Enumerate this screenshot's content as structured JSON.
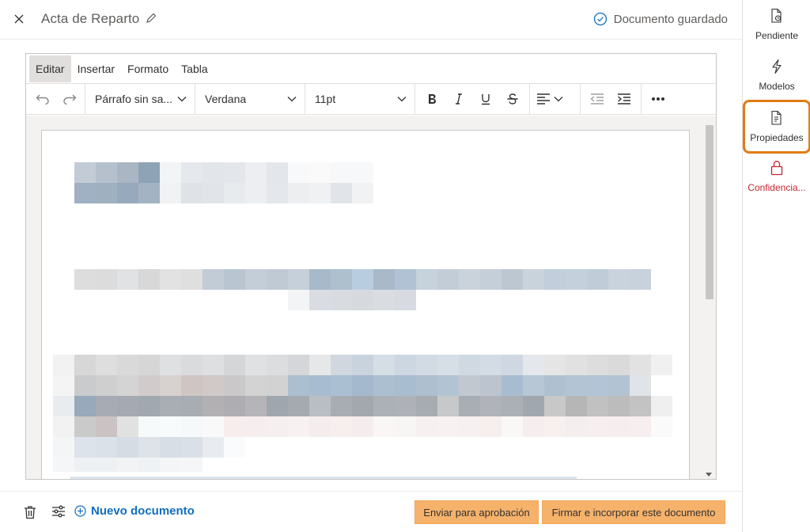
{
  "header": {
    "title": "Acta de Reparto",
    "saved_status": "Documento guardado"
  },
  "menubar": {
    "items": [
      "Editar",
      "Insertar",
      "Formato",
      "Tabla"
    ]
  },
  "toolbar": {
    "paragraph_style": "Párrafo sin sa...",
    "font_family": "Verdana",
    "font_size": "11pt"
  },
  "footer": {
    "new_document": "Nuevo documento",
    "send_for_approval": "Enviar para aprobación",
    "sign_and_attach": "Firmar e incorporar este documento"
  },
  "rail": {
    "items": [
      {
        "label": "Pendiente",
        "icon": "pending-document-icon"
      },
      {
        "label": "Modelos",
        "icon": "lightning-icon"
      },
      {
        "label": "Propiedades",
        "icon": "document-properties-icon"
      },
      {
        "label": "Confidencia...",
        "icon": "lock-icon"
      }
    ]
  },
  "colors": {
    "accent": "#106ebe",
    "primary_button": "#f6b26b",
    "highlight_border": "#e07c14",
    "confidential": "#c4262e"
  }
}
